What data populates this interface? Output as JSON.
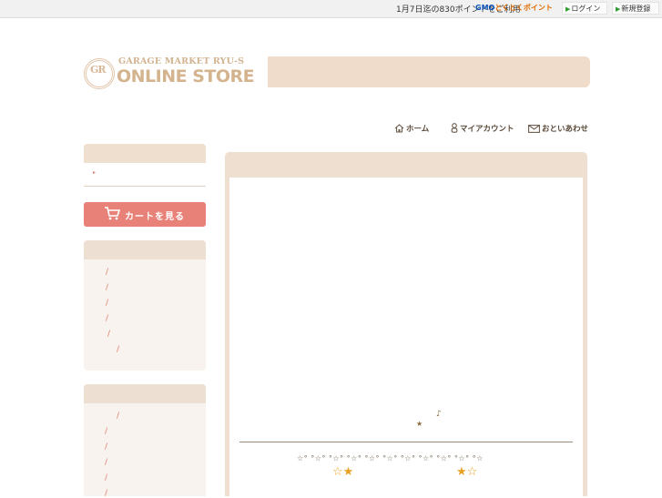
{
  "topbar": {
    "point_text": "1月7日迄の830ポイントをご利用",
    "gmo_brand": "GMO",
    "gmo_text": "とくとくポイント",
    "login_label": "ログイン",
    "register_label": "新規登録"
  },
  "header": {
    "logo_line1": "GARAGE MARKET RYU-S",
    "logo_line2": "ONLINE STORE",
    "logo_seal": "GR"
  },
  "nav": {
    "home": "ホーム",
    "account": "マイアカウント",
    "contact": "おといあわせ"
  },
  "sidebar": {
    "category_arrow": "▸",
    "cart_button_label": "カートを見る",
    "box1_slashes": [
      "/",
      "/",
      "/",
      "/",
      "/",
      "/"
    ],
    "box2_slashes": [
      "/",
      "/",
      "/",
      "/",
      "/",
      "/"
    ]
  },
  "main": {
    "note_symbol": "♪",
    "small_star": "★",
    "star_row": "☆° °☆° °☆° °☆° °☆° °☆° °☆° °☆° °☆° °☆° °☆",
    "star_left": "☆★",
    "star_right": "★☆"
  },
  "colors": {
    "accent_pink": "#e88279",
    "beige_header": "#efdccb",
    "frame_beige": "#efdfd1",
    "star_gold": "#e8a020"
  }
}
